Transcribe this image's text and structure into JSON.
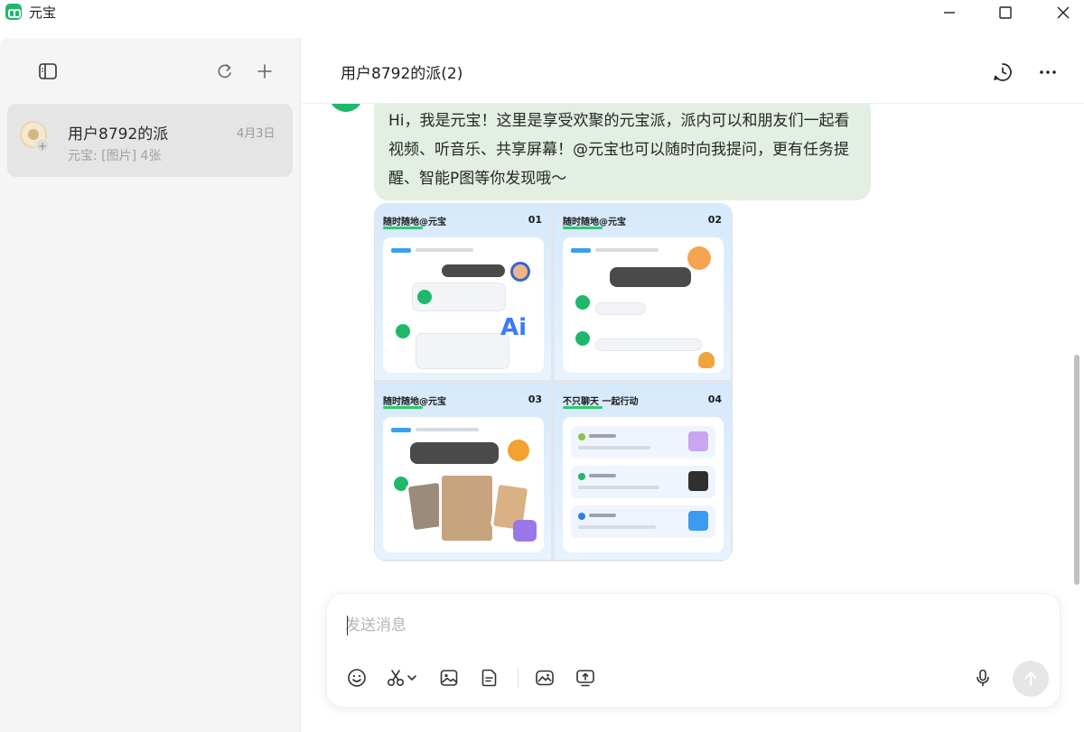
{
  "app": {
    "title": "元宝"
  },
  "window": {
    "min_icon": "minimize-icon",
    "max_icon": "maximize-icon",
    "close_icon": "close-icon"
  },
  "sidebar": {
    "icons": [
      "sidebar-toggle-icon",
      "refresh-icon",
      "plus-icon"
    ],
    "chats": [
      {
        "name": "用户8792的派",
        "date": "4月3日",
        "preview": "元宝: [图片] 4张",
        "badge": "+"
      }
    ]
  },
  "main": {
    "title": "用户8792的派(2)",
    "icons": [
      "history-icon",
      "more-icon"
    ],
    "message": {
      "text": "Hi，我是元宝！这里是享受欢聚的元宝派，派内可以和朋友们一起看视频、听音乐、共享屏幕！@元宝也可以随时向我提问，更有任务提醒、智能P图等你发现哦～"
    },
    "image_grid": {
      "tiles": [
        {
          "title": "随时随地@元宝",
          "num": "01"
        },
        {
          "title": "随时随地@元宝",
          "num": "02"
        },
        {
          "title": "随时随地@元宝",
          "num": "03"
        },
        {
          "title": "不只聊天 一起行动",
          "num": "04"
        }
      ],
      "ai_label": "Ai"
    }
  },
  "composer": {
    "placeholder": "发送消息",
    "value": "",
    "tools": [
      "emoji-icon",
      "scissors-icon",
      "image-icon",
      "document-icon",
      "gallery-icon",
      "screen-share-icon"
    ],
    "mic_icon": "microphone-icon",
    "send_icon": "send-arrow-icon"
  },
  "colors": {
    "accent": "#1fb86a",
    "bubble": "#e2efe2",
    "sidebar_bg": "#f5f5f5",
    "selected_bg": "#e5e5e5"
  }
}
